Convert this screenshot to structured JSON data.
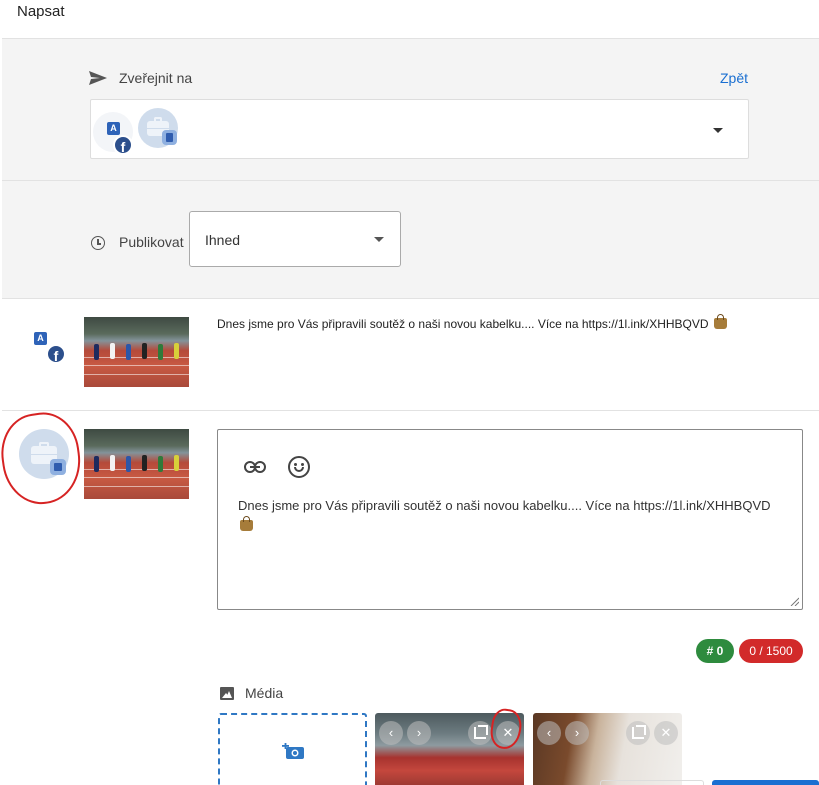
{
  "header": {
    "title": "Napsat"
  },
  "publish": {
    "label": "Zveřejnit na",
    "back_link": "Zpět",
    "accounts": [
      {
        "icon": "facebook-ad-account-icon",
        "badge_a": "A",
        "badge_f": "f"
      },
      {
        "icon": "business-profile-icon"
      }
    ]
  },
  "schedule": {
    "label": "Publikovat",
    "value": "Ihned"
  },
  "posts": [
    {
      "account_icon": "facebook-ad-account-icon",
      "badge_a": "A",
      "badge_f": "f",
      "text": "Dnes jsme pro Vás připravili soutěž o naši novou kabelku.... Více na https://1l.ink/XHHBQVD"
    },
    {
      "account_icon": "business-profile-icon"
    }
  ],
  "editor": {
    "text": "Dnes jsme pro Vás připravili soutěž o naši novou kabelku.... Více na https://1l.ink/XHHBQVD",
    "tools": [
      "link-icon",
      "emoji-icon"
    ]
  },
  "counters": {
    "hashtags": "# 0",
    "characters": "0 / 1500"
  },
  "media": {
    "label": "Média",
    "tile_controls": {
      "prev": "‹",
      "next": "›",
      "remove": "✕"
    }
  },
  "colors": {
    "accent": "#1a6fd1",
    "hashtag_badge": "#2e8b3e",
    "char_badge": "#d22a2a",
    "annotation": "#d62323"
  }
}
